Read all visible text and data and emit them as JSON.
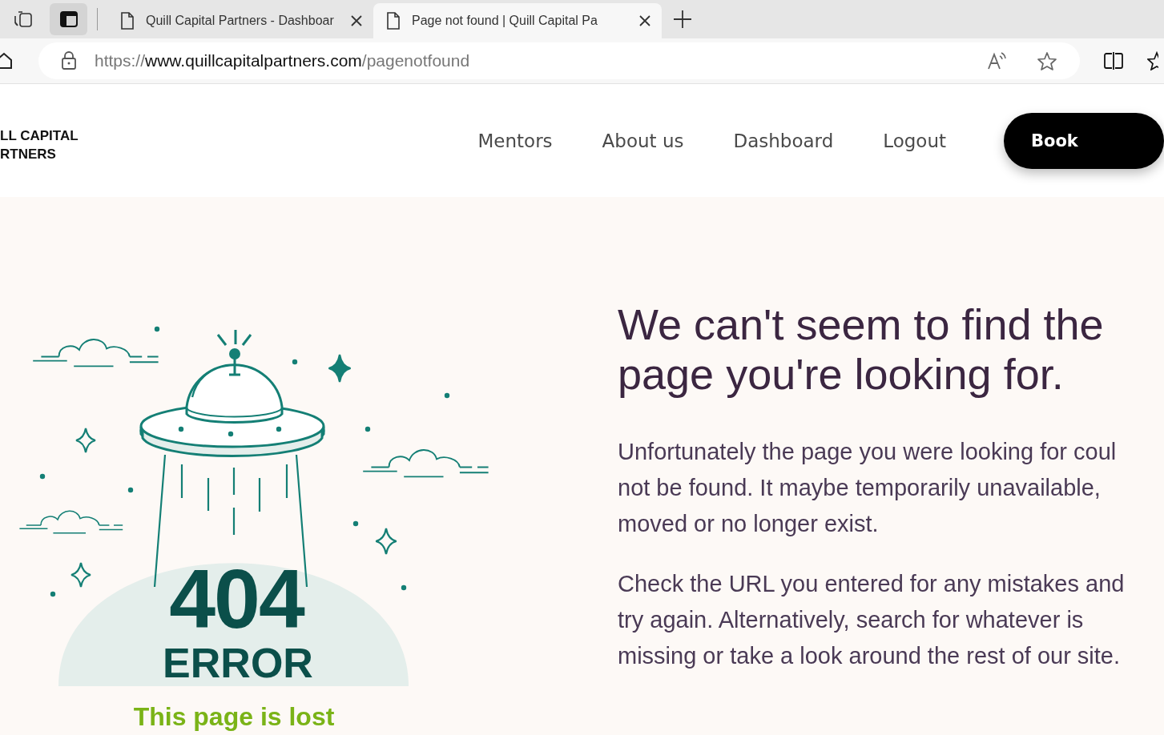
{
  "browser": {
    "tabs": [
      {
        "title": "Quill Capital Partners - Dashboar",
        "selected": false
      },
      {
        "title": "Page not found | Quill Capital Pa",
        "selected": true
      }
    ],
    "url": {
      "scheme": "https://",
      "host": "www.quillcapitalpartners.com",
      "path": "/pagenotfound"
    }
  },
  "site": {
    "logo": [
      "LL CAPITAL",
      "RTNERS"
    ],
    "nav": [
      {
        "label": "Mentors"
      },
      {
        "label": "About us"
      },
      {
        "label": "Dashboard"
      },
      {
        "label": "Logout"
      }
    ],
    "cta": "Book"
  },
  "illustration": {
    "code": "404",
    "label": "ERROR",
    "caption": "This page is lost"
  },
  "content": {
    "heading": "We can't seem to find the\npage you're looking for.",
    "paragraphs": [
      "Unfortunately the page you were looking for coul\nnot be found. It maybe temporarily unavailable,\nmoved or no longer exist.",
      "Check the URL you entered for any mistakes and\ntry again. Alternatively, search for whatever is\nmissing or take a look around the rest of our site."
    ]
  }
}
